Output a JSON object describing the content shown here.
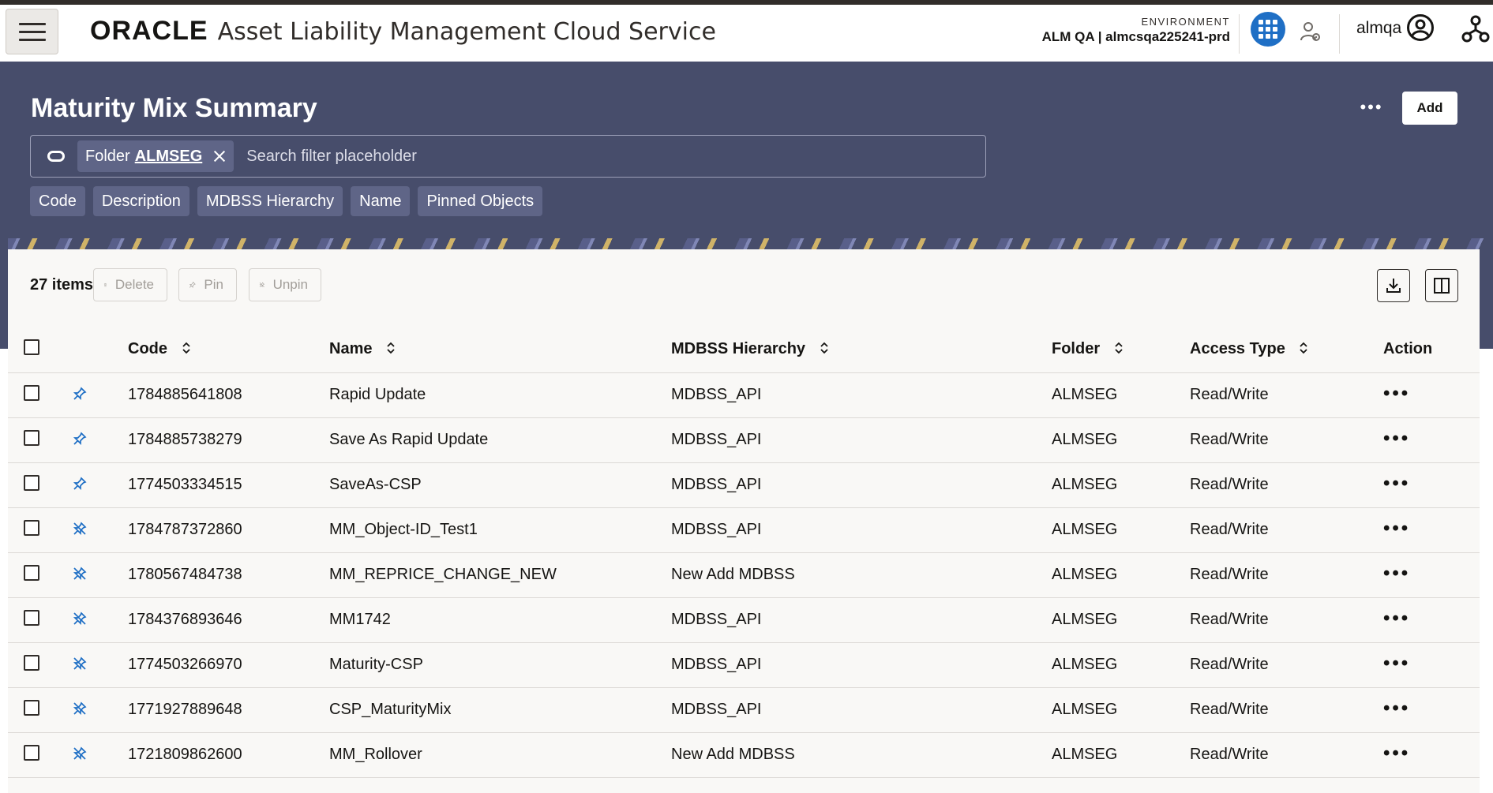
{
  "header": {
    "brand": "ORACLE",
    "app_title": "Asset Liability Management Cloud Service",
    "environment_label": "ENVIRONMENT",
    "environment_value": "ALM QA | almcsqa225241-prd",
    "username": "almqa"
  },
  "page": {
    "title": "Maturity Mix Summary",
    "add_label": "Add",
    "more_label": "•••"
  },
  "search": {
    "chip_label": "Folder",
    "chip_value": "ALMSEG",
    "placeholder": "Search filter placeholder"
  },
  "facets": [
    "Code",
    "Description",
    "MDBSS Hierarchy",
    "Name",
    "Pinned Objects"
  ],
  "toolbar": {
    "items_count": "27 items",
    "delete_label": "Delete",
    "pin_label": "Pin",
    "unpin_label": "Unpin"
  },
  "table": {
    "columns": {
      "code": "Code",
      "name": "Name",
      "hierarchy": "MDBSS Hierarchy",
      "folder": "Folder",
      "access": "Access Type",
      "action": "Action"
    },
    "action_label": "•••",
    "rows": [
      {
        "pinned": true,
        "code": "1784885641808",
        "name": "Rapid Update",
        "hierarchy": "MDBSS_API",
        "folder": "ALMSEG",
        "access": "Read/Write"
      },
      {
        "pinned": true,
        "code": "1784885738279",
        "name": "Save As Rapid Update",
        "hierarchy": "MDBSS_API",
        "folder": "ALMSEG",
        "access": "Read/Write"
      },
      {
        "pinned": true,
        "code": "1774503334515",
        "name": "SaveAs-CSP",
        "hierarchy": "MDBSS_API",
        "folder": "ALMSEG",
        "access": "Read/Write"
      },
      {
        "pinned": false,
        "code": "1784787372860",
        "name": "MM_Object-ID_Test1",
        "hierarchy": "MDBSS_API",
        "folder": "ALMSEG",
        "access": "Read/Write"
      },
      {
        "pinned": false,
        "code": "1780567484738",
        "name": "MM_REPRICE_CHANGE_NEW",
        "hierarchy": "New Add MDBSS",
        "folder": "ALMSEG",
        "access": "Read/Write"
      },
      {
        "pinned": false,
        "code": "1784376893646",
        "name": "MM1742",
        "hierarchy": "MDBSS_API",
        "folder": "ALMSEG",
        "access": "Read/Write"
      },
      {
        "pinned": false,
        "code": "1774503266970",
        "name": "Maturity-CSP",
        "hierarchy": "MDBSS_API",
        "folder": "ALMSEG",
        "access": "Read/Write"
      },
      {
        "pinned": false,
        "code": "1771927889648",
        "name": "CSP_MaturityMix",
        "hierarchy": "MDBSS_API",
        "folder": "ALMSEG",
        "access": "Read/Write"
      },
      {
        "pinned": false,
        "code": "1721809862600",
        "name": "MM_Rollover",
        "hierarchy": "New Add MDBSS",
        "folder": "ALMSEG",
        "access": "Read/Write"
      }
    ]
  },
  "icons": {
    "pinned": "pin-icon",
    "unpinned": "unpin-icon"
  },
  "colors": {
    "banner": "#474d6b",
    "apps_button": "#1f6fc5",
    "chip": "#5f6587"
  }
}
